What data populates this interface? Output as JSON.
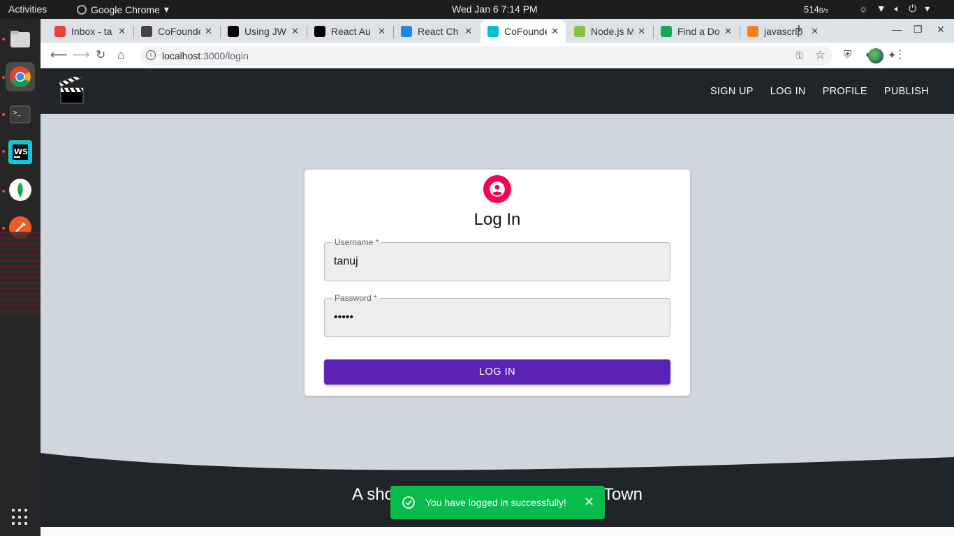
{
  "system": {
    "activities": "Activities",
    "app_name": "Google Chrome",
    "clock": "Wed Jan 6   7:14 PM",
    "net_speed": "514",
    "net_unit": "B/s"
  },
  "browser": {
    "tabs": [
      {
        "label": "Inbox - ta",
        "favicon": "gmail-icon",
        "color": "#ea4335"
      },
      {
        "label": "CoFounde",
        "favicon": "globe-icon",
        "color": "#444444"
      },
      {
        "label": "Using JW",
        "favicon": "medium-icon",
        "color": "#000000"
      },
      {
        "label": "React Au",
        "favicon": "medium-icon",
        "color": "#000000"
      },
      {
        "label": "React Ch",
        "favicon": "mui-icon",
        "color": "#1e88e5"
      },
      {
        "label": "CoFounde",
        "favicon": "react-icon",
        "color": "#00bcd4",
        "active": true
      },
      {
        "label": "Node.js M",
        "favicon": "w3-icon",
        "color": "#8bc34a"
      },
      {
        "label": "Find a Do",
        "favicon": "mongodb-icon",
        "color": "#13aa52"
      },
      {
        "label": "javascrip",
        "favicon": "stackoverflow-icon",
        "color": "#f48024"
      }
    ],
    "url_host": "localhost",
    "url_path": ":3000/login"
  },
  "navbar": {
    "links": [
      "SIGN UP",
      "LOG IN",
      "PROFILE",
      "PUBLISH"
    ]
  },
  "login": {
    "title": "Log In",
    "username_label": "Username *",
    "username_value": "tanuj",
    "password_label": "Password *",
    "password_value": "•••••",
    "button_label": "LOG IN",
    "accent_color": "#f50057",
    "button_color": "#5b22b5"
  },
  "footer": {
    "tagline_left": "A sho",
    "tagline_right": "Town"
  },
  "toast": {
    "message": "You have logged in successfully!",
    "color": "#07bc4c"
  }
}
